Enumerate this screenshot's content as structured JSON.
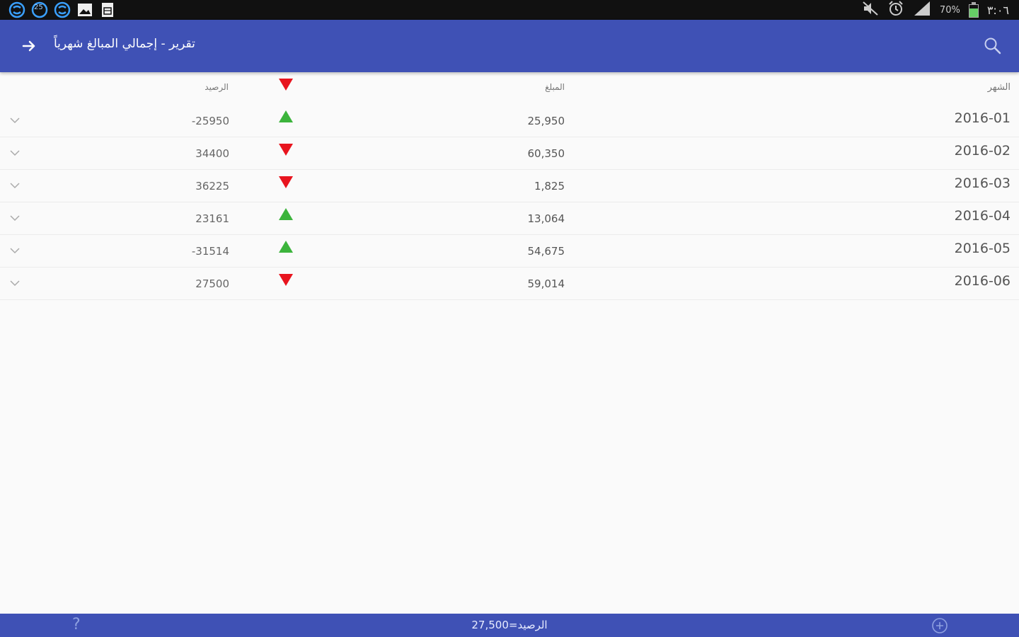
{
  "status_bar": {
    "notifications": [
      "s-app-icon",
      "calendar-25-icon",
      "s-app-icon",
      "gallery-icon",
      "document-icon"
    ],
    "calendar_day": "25",
    "battery": "70%",
    "time": "٣:٠٦",
    "icons": [
      "mute-icon",
      "alarm-icon",
      "signal-icon",
      "battery-icon"
    ]
  },
  "toolbar": {
    "title": "تقرير - إجمالي المبالغ شهرياً",
    "back_icon": "arrow-right-icon",
    "search_icon": "search-icon",
    "bg_color": "#3f51b5"
  },
  "table": {
    "headers": {
      "month": "الشهر",
      "amount": "المبلغ",
      "balance": "الرصيد",
      "header_arrow": "down"
    },
    "rows": [
      {
        "month": "2016-01",
        "amount": "25,950",
        "trend": "up",
        "balance": "-25950"
      },
      {
        "month": "2016-02",
        "amount": "60,350",
        "trend": "down",
        "balance": "34400"
      },
      {
        "month": "2016-03",
        "amount": "1,825",
        "trend": "down",
        "balance": "36225"
      },
      {
        "month": "2016-04",
        "amount": "13,064",
        "trend": "up",
        "balance": "23161"
      },
      {
        "month": "2016-05",
        "amount": "54,675",
        "trend": "up",
        "balance": "-31514"
      },
      {
        "month": "2016-06",
        "amount": "59,014",
        "trend": "down",
        "balance": "27500"
      }
    ],
    "colors": {
      "up": "#3cb43c",
      "down": "#e8141e"
    }
  },
  "bottom_bar": {
    "help_label": "?",
    "balance_text": "الرصيد=27,500",
    "add_icon": "add-circle-icon"
  }
}
